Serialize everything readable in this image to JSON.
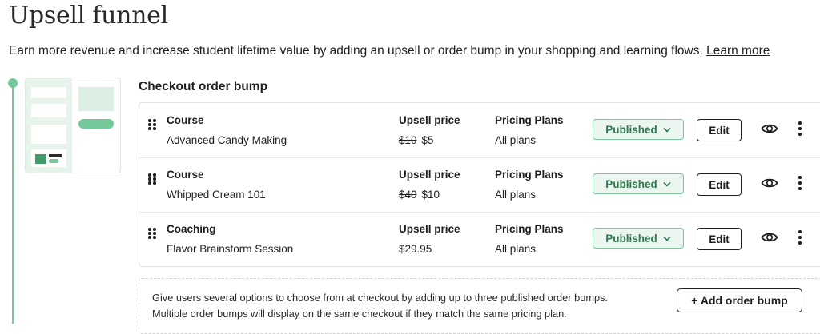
{
  "page": {
    "title": "Upsell funnel",
    "subtitle": "Earn more revenue and increase student lifetime value by adding an upsell or order bump in your shopping and learning flows.",
    "learn_more": "Learn more"
  },
  "section": {
    "title": "Checkout order bump"
  },
  "columns": {
    "price_label": "Upsell price",
    "plans_label": "Pricing Plans"
  },
  "rows": [
    {
      "type": "Course",
      "name": "Advanced Candy Making",
      "original_price": "$10",
      "price": "$5",
      "plans": "All plans",
      "status": "Published",
      "edit": "Edit"
    },
    {
      "type": "Course",
      "name": "Whipped Cream 101",
      "original_price": "$40",
      "price": "$10",
      "plans": "All plans",
      "status": "Published",
      "edit": "Edit"
    },
    {
      "type": "Coaching",
      "name": "Flavor Brainstorm Session",
      "original_price": "",
      "price": "$29.95",
      "plans": "All plans",
      "status": "Published",
      "edit": "Edit"
    }
  ],
  "info": {
    "text_line1": "Give users several options to choose from at checkout by adding up to three published order bumps.",
    "text_line2": "Multiple order bumps will display on the same checkout if they match the same pricing plan.",
    "add_button": "+ Add order bump"
  },
  "colors": {
    "accent_green": "#73c99a",
    "status_border": "#7ac89b",
    "status_bg": "#eaf6ef",
    "status_text": "#2f7a4e"
  },
  "icons": {
    "drag": "drag-handle-icon",
    "chevron": "chevron-down-icon",
    "eye": "eye-icon",
    "more": "more-vertical-icon"
  }
}
